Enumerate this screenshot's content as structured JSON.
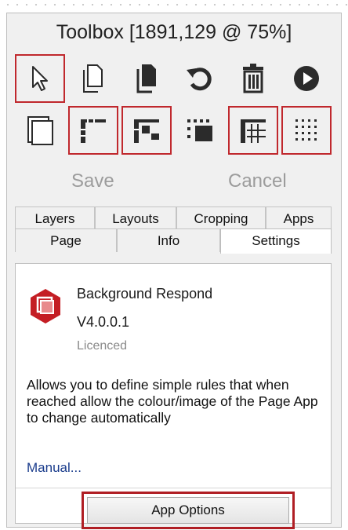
{
  "window": {
    "title": "Toolbox [1891,129 @  75%]"
  },
  "toolbar": {
    "row1": [
      {
        "icon": "pointer-arrow-icon",
        "selected": true
      },
      {
        "icon": "copy-page-icon",
        "selected": false
      },
      {
        "icon": "paste-page-icon",
        "selected": false
      },
      {
        "icon": "undo-rotate-icon",
        "selected": false
      },
      {
        "icon": "trash-icon",
        "selected": false
      },
      {
        "icon": "play-icon",
        "selected": false
      }
    ],
    "row2": [
      {
        "icon": "page-frame-icon",
        "selected": false
      },
      {
        "icon": "layout-corner-icon",
        "selected": true
      },
      {
        "icon": "layout-grid-small-icon",
        "selected": true
      },
      {
        "icon": "dotted-layout-icon",
        "selected": false
      },
      {
        "icon": "layout-table-icon",
        "selected": true
      },
      {
        "icon": "dot-grid-icon",
        "selected": true
      }
    ],
    "save_label": "Save",
    "cancel_label": "Cancel"
  },
  "tabs": {
    "row1": [
      "Layers",
      "Layouts",
      "Cropping",
      "Apps"
    ],
    "row2": [
      "Page",
      "Info",
      "Settings"
    ],
    "active": "Settings"
  },
  "app": {
    "name": "Background Respond",
    "version": "V4.0.0.1",
    "license": "Licenced",
    "description": "Allows you to define simple rules that when reached allow the colour/image of the Page App to change automatically",
    "manual_link": "Manual...",
    "options_button": "App Options"
  },
  "colors": {
    "accent_red": "#c0282d",
    "hexagon_red": "#c41e24",
    "icon_dark": "#2b2b2b"
  }
}
